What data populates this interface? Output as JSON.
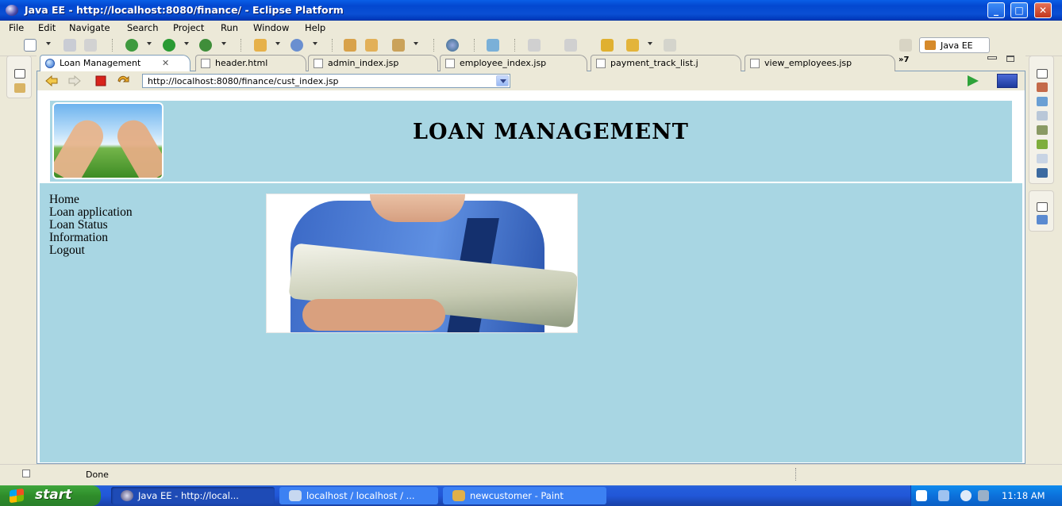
{
  "window": {
    "title": "Java EE - http://localhost:8080/finance/ - Eclipse Platform",
    "controls": {
      "minimize": "_",
      "maximize": "□",
      "close": "✕"
    }
  },
  "menu": {
    "items": [
      "File",
      "Edit",
      "Navigate",
      "Search",
      "Project",
      "Run",
      "Window",
      "Help"
    ]
  },
  "perspective": {
    "label": "Java EE"
  },
  "tabs": [
    {
      "label": "Loan Management",
      "close": "✕"
    },
    {
      "label": "header.html"
    },
    {
      "label": "admin_index.jsp"
    },
    {
      "label": "employee_index.jsp"
    },
    {
      "label": "payment_track_list.j"
    },
    {
      "label": "view_employees.jsp"
    }
  ],
  "tabs_overflow": "»7",
  "browser": {
    "url": "http://localhost:8080/finance/cust_index.jsp"
  },
  "page": {
    "title": "LOAN MANAGEMENT",
    "nav": [
      "Home",
      "Loan application",
      "Loan Status",
      "Information",
      "Logout"
    ],
    "colors": {
      "background": "#a8d6e3"
    }
  },
  "status": {
    "text": "Done"
  },
  "taskbar": {
    "start": "start",
    "buttons": [
      {
        "label": "Java EE - http://local..."
      },
      {
        "label": "localhost / localhost / ..."
      },
      {
        "label": "newcustomer - Paint"
      }
    ],
    "clock": "11:18 AM"
  }
}
